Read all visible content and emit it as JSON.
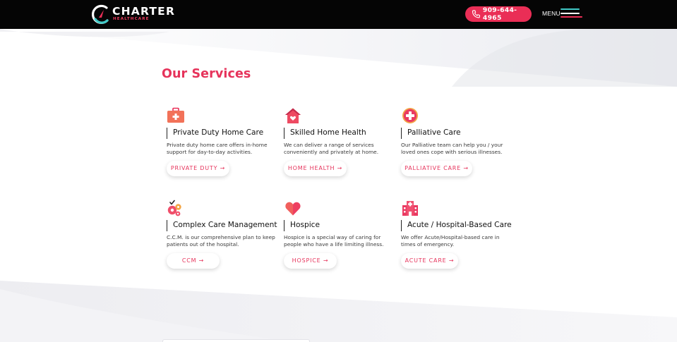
{
  "header": {
    "logo_name": "CHARTER",
    "logo_sub": "HEALTHCARE",
    "phone": "909-644-4965",
    "menu_label": "MENU"
  },
  "services": {
    "title": "Our Services",
    "items": [
      {
        "name": "Private Duty Home Care",
        "desc": "Private duty home care offers in-home support for day-to-day activities.",
        "button": "PRIVATE DUTY →",
        "icon": "medical-bag-icon"
      },
      {
        "name": "Skilled Home Health",
        "desc": "We can deliver a range of services conveniently and privately at home.",
        "button": "HOME HEALTH →",
        "icon": "home-heart-icon"
      },
      {
        "name": "Palliative Care",
        "desc": "Our Palliative team can help you / your loved ones cope with serious illnesses.",
        "button": "PALLIATIVE CARE →",
        "icon": "medical-cross-icon"
      },
      {
        "name": "Complex Care Management",
        "desc": "C.C.M. is our comprehensive plan to keep patients out of the hospital.",
        "button": "CCM →",
        "icon": "gears-check-icon"
      },
      {
        "name": "Hospice",
        "desc": "Hospice is a special way of caring for people who have a life limiting illness.",
        "button": "HOSPICE →",
        "icon": "heart-icon"
      },
      {
        "name": "Acute / Hospital-Based Care",
        "desc": "We offer Acute/Hospital-based care in times of emergency.",
        "button": "ACUTE CARE →",
        "icon": "hospital-icon"
      }
    ]
  },
  "colors": {
    "accent": "#e6335b",
    "teal": "#40c9c7",
    "header_bg": "#050505"
  }
}
